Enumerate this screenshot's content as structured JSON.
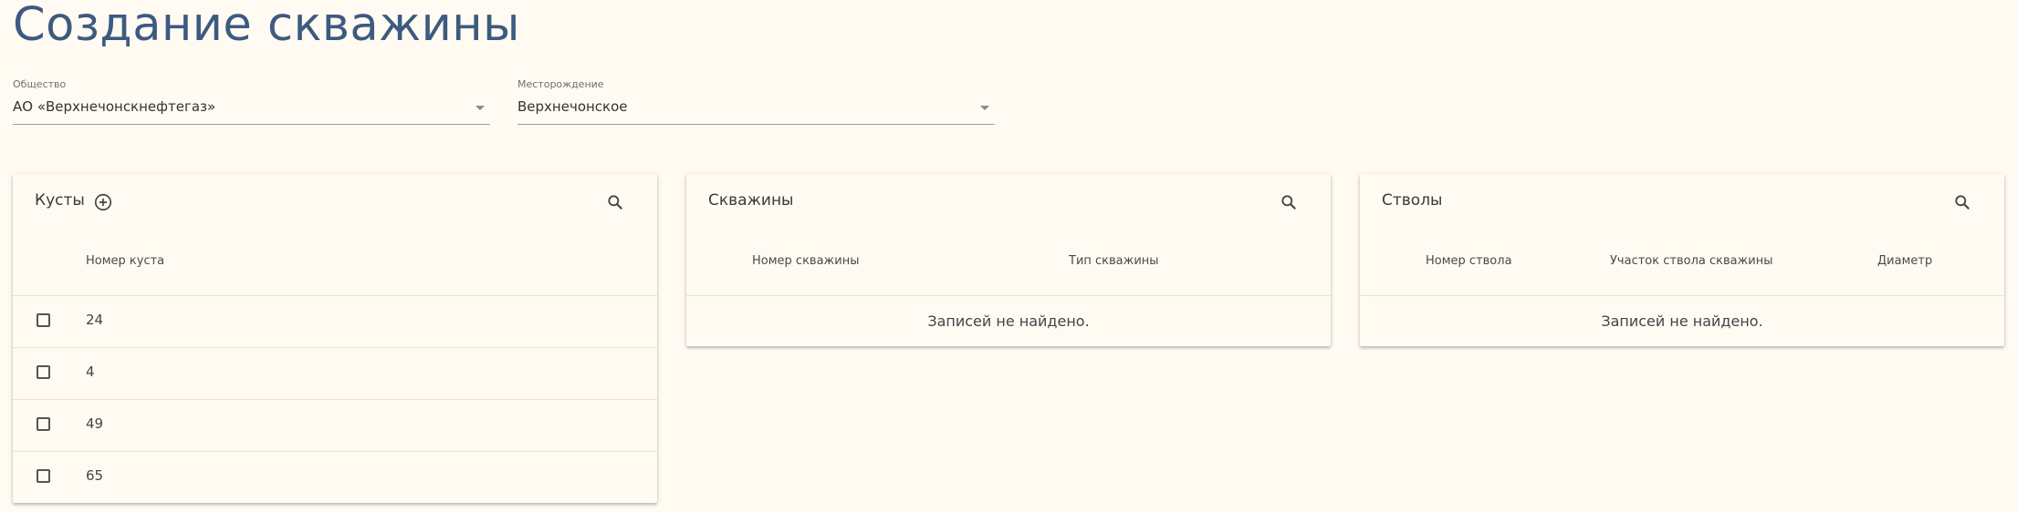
{
  "page": {
    "title": "Создание скважины"
  },
  "filters": {
    "company": {
      "label": "Общество",
      "value": "АО «Верхнечонскнефтегаз»"
    },
    "field": {
      "label": "Месторождение",
      "value": "Верхнечонское"
    }
  },
  "clusters": {
    "title": "Кусты",
    "columns": [
      "Номер куста"
    ],
    "rows": [
      "24",
      "4",
      "49",
      "65"
    ]
  },
  "wells": {
    "title": "Скважины",
    "columns": [
      "Номер скважины",
      "Тип скважины"
    ],
    "empty": "Записей не найдено."
  },
  "bores": {
    "title": "Стволы",
    "columns": [
      "Номер ствола",
      "Участок ствола скважины",
      "Диаметр"
    ],
    "empty": "Записей не найдено."
  },
  "colors": {
    "background": "#fffbf3",
    "title": "#3d5a80",
    "text": "#333333"
  },
  "icons": {
    "add": "add-circle-icon",
    "search": "search-icon",
    "dropdown": "chevron-down-icon",
    "checkbox": "checkbox-icon"
  }
}
